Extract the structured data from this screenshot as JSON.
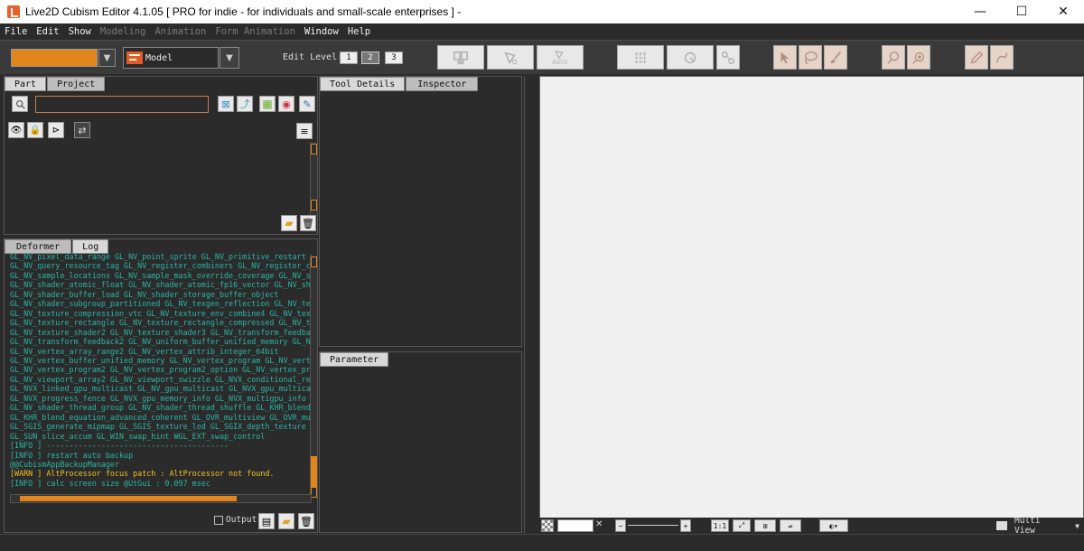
{
  "window": {
    "title": "Live2D Cubism Editor 4.1.05   [ PRO for indie - for individuals and small-scale enterprises ]  -",
    "minimize": "—",
    "maximize": "☐",
    "close": "✕"
  },
  "menu": {
    "items": [
      {
        "label": "File",
        "enabled": true
      },
      {
        "label": "Edit",
        "enabled": true
      },
      {
        "label": "Show",
        "enabled": true
      },
      {
        "label": "Modeling",
        "enabled": false
      },
      {
        "label": "Animation",
        "enabled": false
      },
      {
        "label": "Form Animation",
        "enabled": false
      },
      {
        "label": "Window",
        "enabled": true
      },
      {
        "label": "Help",
        "enabled": true
      }
    ]
  },
  "toolbar": {
    "document_select": "",
    "model_label": "Model",
    "edit_level_label": "Edit Level:",
    "levels": [
      "1",
      "2",
      "3"
    ],
    "selected_level": "2",
    "auto_label": "AUTO"
  },
  "part_panel": {
    "tabs": [
      "Part",
      "Project"
    ],
    "search_placeholder": ""
  },
  "deformer_panel": {
    "tabs": [
      "Deformer",
      "Log"
    ],
    "output_label": "Output"
  },
  "log": {
    "lines": [
      {
        "type": "gl",
        "text": "GL_NV_pixel_data_range GL_NV_point_sprite GL_NV_primitive_restart GL_"
      },
      {
        "type": "gl",
        "text": "GL_NV_query_resource_tag GL_NV_register_combiners GL_NV_register_com"
      },
      {
        "type": "gl",
        "text": "GL_NV_sample_locations GL_NV_sample_mask_override_coverage GL_NV_sha"
      },
      {
        "type": "gl",
        "text": "GL_NV_shader_atomic_float GL_NV_shader_atomic_fp16_vector GL_NV_shad"
      },
      {
        "type": "gl",
        "text": "GL_NV_shader_buffer_load GL_NV_shader_storage_buffer_object"
      },
      {
        "type": "gl",
        "text": "GL_NV_shader_subgroup_partitioned GL_NV_texgen_reflection GL_NV_text"
      },
      {
        "type": "gl",
        "text": "GL_NV_texture_compression_vtc GL_NV_texture_env_combine4 GL_NV_textu"
      },
      {
        "type": "gl",
        "text": "GL_NV_texture_rectangle GL_NV_texture_rectangle_compressed GL_NV_tex"
      },
      {
        "type": "gl",
        "text": "GL_NV_texture_shader2 GL_NV_texture_shader3 GL_NV_transform_feedback"
      },
      {
        "type": "gl",
        "text": "GL_NV_transform_feedback2 GL_NV_uniform_buffer_unified_memory GL_NV_"
      },
      {
        "type": "gl",
        "text": "GL_NV_vertex_array_range2 GL_NV_vertex_attrib_integer_64bit"
      },
      {
        "type": "gl",
        "text": "GL_NV_vertex_buffer_unified_memory GL_NV_vertex_program GL_NV_vertex_"
      },
      {
        "type": "gl",
        "text": "GL_NV_vertex_program2 GL_NV_vertex_program2_option GL_NV_vertex_prog"
      },
      {
        "type": "gl",
        "text": "GL_NV_viewport_array2 GL_NV_viewport_swizzle GL_NVX_conditional_rende"
      },
      {
        "type": "gl",
        "text": "GL_NVX_linked_gpu_multicast GL_NV_gpu_multicast GL_NVX_gpu_multicast"
      },
      {
        "type": "gl",
        "text": "GL_NVX_progress_fence GL_NVX_gpu_memory_info GL_NVX_multigpu_info GL"
      },
      {
        "type": "gl",
        "text": "GL_NV_shader_thread_group GL_NV_shader_thread_shuffle GL_KHR_blend_e"
      },
      {
        "type": "gl",
        "text": "GL_KHR_blend_equation_advanced_coherent GL_OVR_multiview GL_OVR_mult"
      },
      {
        "type": "gl",
        "text": "GL_SGIS_generate_mipmap GL_SGIS_texture_lod GL_SGIX_depth_texture GL"
      },
      {
        "type": "gl",
        "text": "GL_SUN_slice_accum GL_WIN_swap_hint WGL_EXT_swap_control"
      },
      {
        "type": "info",
        "text": "[INFO ] ----------------------------------------"
      },
      {
        "type": "info",
        "text": "[INFO ] restart auto backup"
      },
      {
        "type": "plain",
        "text": "@@CubismAppBackupManager"
      },
      {
        "type": "warn",
        "text": "[WARN ] AltProcessor focus patch : AltProcessor not found."
      },
      {
        "type": "info",
        "text": "[INFO ] calc screen size @UtGui : 0.097 msec"
      }
    ]
  },
  "tool_panel": {
    "tabs": [
      "Tool Details",
      "Inspector"
    ]
  },
  "parameter_panel": {
    "tabs": [
      "Parameter"
    ]
  },
  "viewbar": {
    "zoom": "",
    "ratio_label": "1:1",
    "multi_view_label": "Multi View"
  },
  "colors": {
    "accent": "#e0861c",
    "log_text": "#2ab6a4",
    "warn_text": "#f0c020"
  }
}
